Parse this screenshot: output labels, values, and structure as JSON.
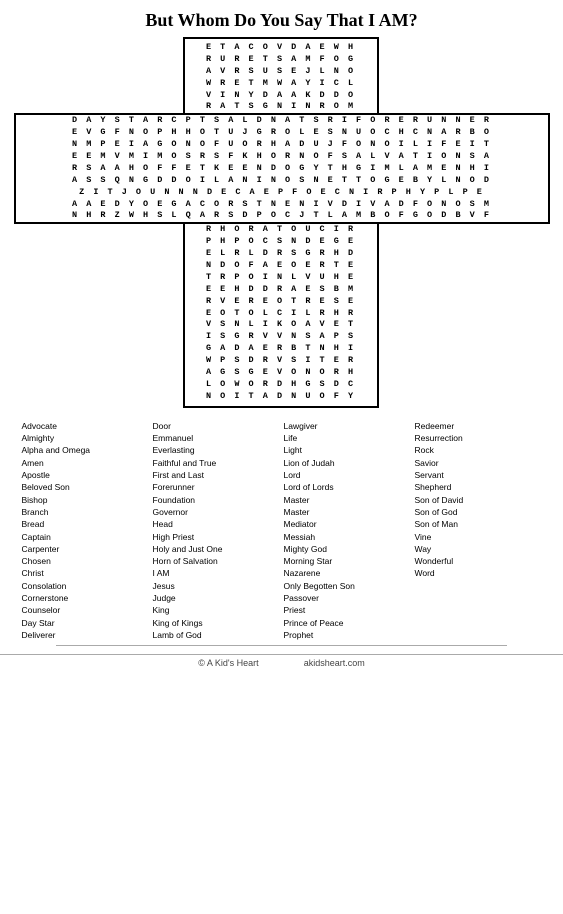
{
  "title": "But Whom Do You Say That I AM?",
  "puzzle": {
    "top_rows": [
      "E T A C O V D A E W H",
      "R U R E T S A M F O G",
      "A V R S U S E J L N O",
      "W R E T M W A Y I C L",
      "V I N Y D A A K D D O",
      "R A T S G N I N R O M"
    ],
    "middle_rows": [
      "D A Y S T A R C P T S A L D N A T S R I F O R E R U N N E R",
      "E V G F N O P H H O T U J G R O L E S N U O C H C N A R B O",
      "N M P E I A G O N O F U O R H A D U J F O N O I L I F E I T",
      "E E M V M I M O S R S F K H O R N O F S A L V A T I O N S A",
      "R S A A H O F F E T K E E N D O G Y T H G I M L A M E N H I",
      "A S S Q N G D D O I L A N I N O S N E T T O G E B Y L N O D",
      "Z I T J O U N N N D E C A E P F O E C N I R P H Y P L P E",
      "A A E D Y O E G A C O R S T N E N I V D I V A D F O N O S M",
      "N H R Z W H S L Q A R S D P O C J T L A M B O F G O D B V F"
    ],
    "center_rows": [
      "R H O R A T O U C I R",
      "P H P O C S N D E G E",
      "E L R L D R S G R H D",
      "N D O F A E O E R T E",
      "T R P O I N L V U H E",
      "E E H D D R A E S B M",
      "R V E R E O T R E S E",
      "E O T O L C I L R H R",
      "V S N L I K O A V E T",
      "I S G R V V N S A P S",
      "G A D A E R B T N H I",
      "W P S D R V S I T E R",
      "A G S G E V O N O R H",
      "L O W O R D H G S D C",
      "N O I T A D N U O F Y"
    ]
  },
  "word_columns": {
    "col1": [
      "Advocate",
      "Almighty",
      "Alpha and Omega",
      "Amen",
      "Apostle",
      "Beloved Son",
      "Bishop",
      "Branch",
      "Bread",
      "Captain",
      "Carpenter",
      "Chosen",
      "Christ",
      "Consolation",
      "Cornerstone",
      "Counselor",
      "Day Star",
      "Deliverer"
    ],
    "col2": [
      "Door",
      "Emmanuel",
      "Everlasting",
      "Faithful and True",
      "First and Last",
      "Forerunner",
      "Foundation",
      "Governor",
      "Head",
      "High Priest",
      "Holy and Just One",
      "Horn of Salvation",
      "I AM",
      "Jesus",
      "Judge",
      "King",
      "King of Kings",
      "Lamb of God"
    ],
    "col3": [
      "Lawgiver",
      "Life",
      "Light",
      "Lion of Judah",
      "Lord",
      "Lord of Lords",
      "Master",
      "Master",
      "Mediator",
      "Messiah",
      "Mighty God",
      "Morning Star",
      "Nazarene",
      "Only Begotten Son",
      "Passover",
      "Priest",
      "Prince of Peace",
      "Prophet"
    ],
    "col4": [
      "Redeemer",
      "Resurrection",
      "Rock",
      "Savior",
      "Servant",
      "Shepherd",
      "Son of David",
      "Son of God",
      "Son of Man",
      "Vine",
      "Way",
      "Wonderful",
      "Word",
      "",
      "",
      "",
      "",
      ""
    ]
  },
  "footer": {
    "left": "© A Kid's Heart",
    "right": "akidsheart.com"
  }
}
